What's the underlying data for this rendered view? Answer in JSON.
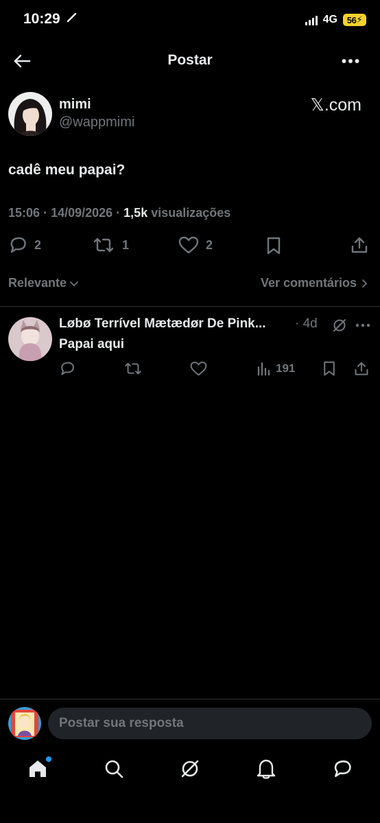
{
  "status_bar": {
    "time": "10:29",
    "network": "4G",
    "battery": "56"
  },
  "header": {
    "title": "Postar"
  },
  "post": {
    "author_name": "mimi",
    "author_handle": "@wappmimi",
    "source": "𝕏.com",
    "text": "cadê meu papai?",
    "time": "15:06",
    "date": "14/09/2026",
    "views_count": "1,5k",
    "views_label": "visualizações",
    "replies": "2",
    "reposts": "1",
    "likes": "2"
  },
  "comments_bar": {
    "sort_label": "Relevante",
    "view_comments": "Ver comentários"
  },
  "reply": {
    "author_name": "Løbø Terrível Mætædør De Pink...",
    "time": "· 4d",
    "text": "Papai aqui",
    "views": "191"
  },
  "composer": {
    "placeholder": "Postar sua resposta"
  },
  "colors": {
    "background": "#000000",
    "text": "#e7e9ea",
    "muted": "#71767b",
    "accent": "#1d9bf0",
    "battery": "#f5d32d"
  }
}
